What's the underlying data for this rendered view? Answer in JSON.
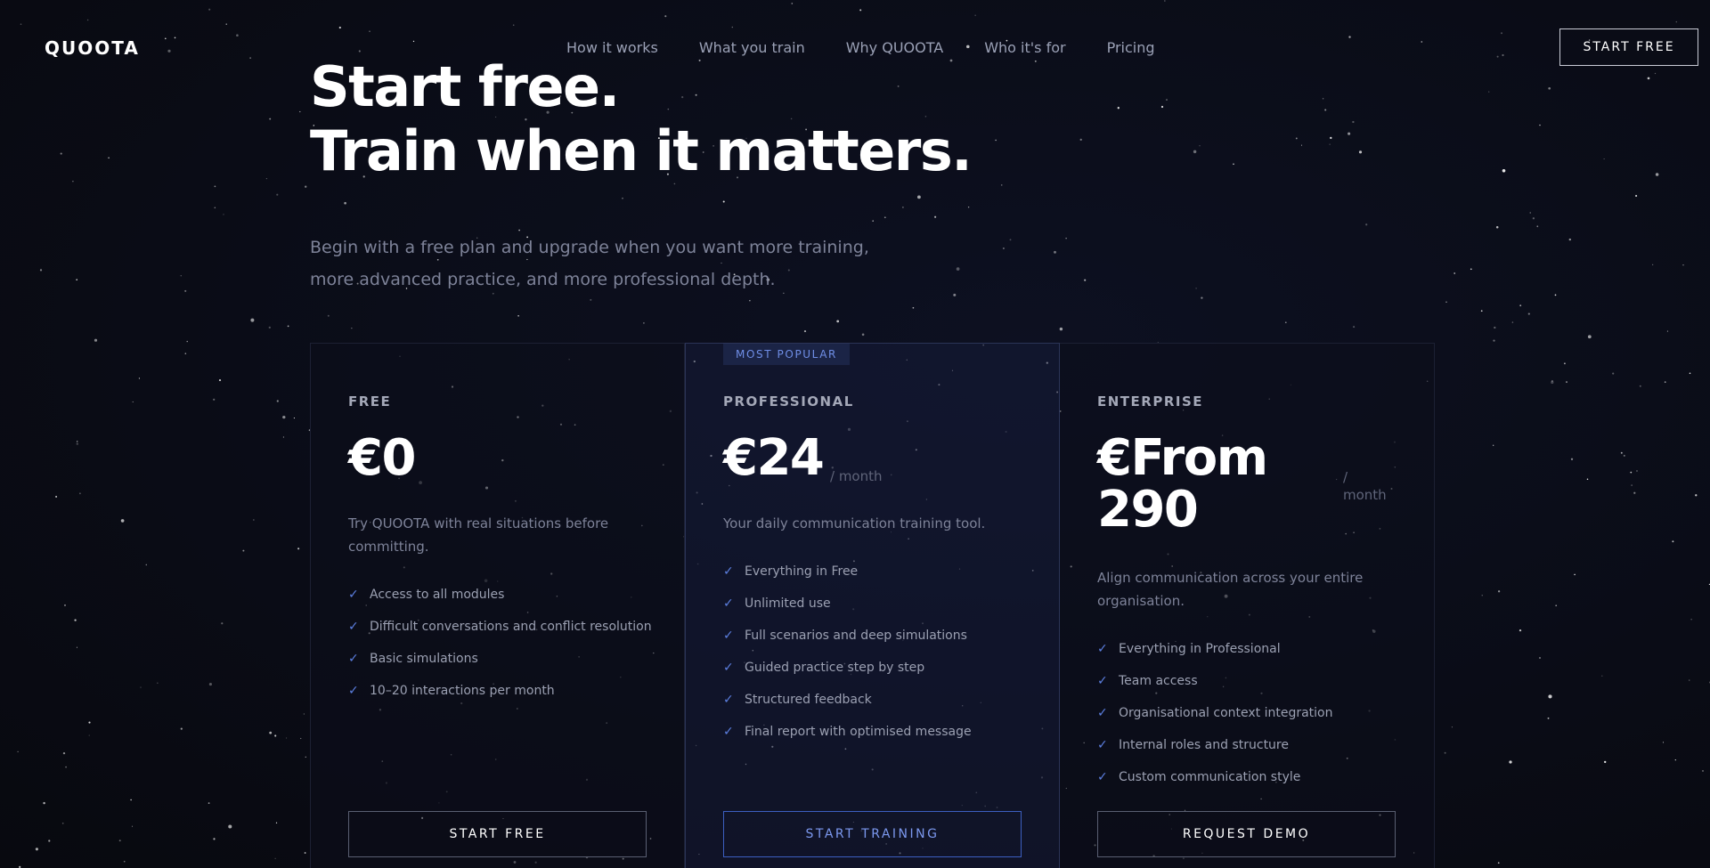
{
  "header": {
    "logo": "QUOOTA",
    "nav": [
      "How it works",
      "What you train",
      "Why QUOOTA",
      "Who it's for",
      "Pricing"
    ],
    "cta_label": "START FREE"
  },
  "hero": {
    "title_line1": "Start free.",
    "title_line2": "Train when it matters.",
    "subtitle_line1": "Begin with a free plan and upgrade when you want more training,",
    "subtitle_line2": "more advanced practice, and more professional depth."
  },
  "plans": [
    {
      "name": "FREE",
      "price": "€0",
      "description": "Try QUOOTA with real situations before committing.",
      "features": [
        "Access to all modules",
        "Difficult conversations and conflict resolution",
        "Basic simulations",
        "10–20 interactions per month"
      ],
      "button_label": "START FREE"
    },
    {
      "badge": "MOST POPULAR",
      "name": "PROFESSIONAL",
      "price": "€24",
      "period": "/ month",
      "description": "Your daily communication training tool.",
      "features": [
        "Everything in Free",
        "Unlimited use",
        "Full scenarios and deep simulations",
        "Guided practice step by step",
        "Structured feedback",
        "Final report with optimised message"
      ],
      "button_label": "START TRAINING"
    },
    {
      "name": "ENTERPRISE",
      "price_line1": "€From",
      "price_line2": "290",
      "period": "/ month",
      "description": "Align communication across your entire organisation.",
      "features": [
        "Everything in Professional",
        "Team access",
        "Organisational context integration",
        "Internal roles and structure",
        "Custom communication style"
      ],
      "button_label": "REQUEST DEMO"
    }
  ],
  "colors": {
    "background": "#0b0d17",
    "accent": "#5c7fe0",
    "featured_card": "#161c38"
  },
  "icons": {
    "feature_check": "check-icon"
  }
}
